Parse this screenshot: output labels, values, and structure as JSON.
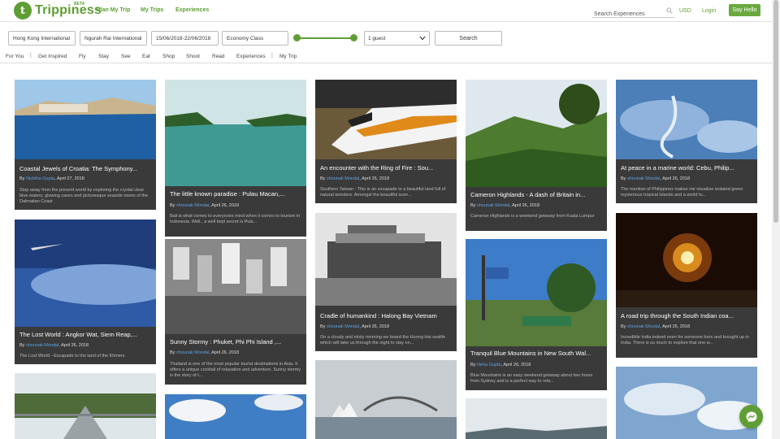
{
  "brand": {
    "name": "Trippiness",
    "beta": "BETA",
    "logo_letter": "t",
    "color": "#5f9e34"
  },
  "nav": {
    "items": [
      "Plan My Trip",
      "My Trips",
      "Experiences"
    ]
  },
  "header": {
    "search_placeholder": "Search Experiences",
    "currency": "USD",
    "login": "Login",
    "say_hello": "Say Hello"
  },
  "search": {
    "from": "Hong Kong International",
    "to": "Ngurah Rai International",
    "dates": "15/06/2018-22/06/2018",
    "cabin": "Economy Class",
    "guests": "1 guest",
    "button": "Search"
  },
  "tabs": [
    "For You",
    "Get Inspired",
    "Fly",
    "Stay",
    "See",
    "Eat",
    "Shop",
    "Shoot",
    "Read",
    "Experiences",
    "My Trip"
  ],
  "cards": [
    {
      "title": "Coastal Jewels of Croatia: The Symphony...",
      "author": "Nishtha Gupta",
      "date": ", April 27, 2018",
      "desc": "Step away from the present world by exploring the crystal clear blue waters, glowing caves and picturesque seaside towns of the Dalmatian Coast",
      "by": "By "
    },
    {
      "title": "The Lost World : Angkor Wat, Siem Reap,...",
      "author": "shounak Mondal",
      "date": ", April 26, 2018",
      "desc": "The Lost World - Escapade to the land of the Khmers",
      "by": "By "
    },
    {
      "title": "The little known paradise : Pulau Macan,...",
      "author": "shounak Mondal",
      "date": ", April 26, 2018",
      "desc": "Bali is what comes to everyones mind when it comes to tourism in Indonesia. Well , a well kept secret is Pula...",
      "by": "By "
    },
    {
      "title": "Sunny Stormy : Phuket, Phi Phi Island ,...",
      "author": "shounak Mondal",
      "date": ", April 26, 2018",
      "desc": "Thailand is one of the most popular tourist destinations in Asia. It offers a unique cocktail of relaxation and adventure, Sunny stormy is the story of t...",
      "by": "By "
    },
    {
      "title": "An encounter with the Ring of Fire : Sou...",
      "author": "shounak Mondal",
      "date": ", April 26, 2018",
      "desc": "Southern Taiwan - This is an escapade to a beautiful land full of natural wonders. Amongst the beautiful scen...",
      "by": "By "
    },
    {
      "title": "Cradle of humankind : Halong Bay Vietnam",
      "author": "shounak Mondal",
      "date": ", April 26, 2018",
      "desc": "On a cloudy and misty morning we board the Huong Hai sealife which will take us through the night to stay on...",
      "by": "By "
    },
    {
      "title": "Cameron Highlands - A dash of Britain in...",
      "author": "shounak Mondal",
      "date": ", April 26, 2018",
      "desc": "Cameron Highlands is a weekend getaway from Kuala Lumpur",
      "by": "By "
    },
    {
      "title": "Tranquil Blue Mountains in New South Wal...",
      "author": "Neha Gupta",
      "date": ", April 26, 2018",
      "desc": "Blue Mountains is an easy weekend getaway about two hours from Sydney and is a perfect way to rela...",
      "by": "By "
    },
    {
      "title": "At peace in a marine world: Cebu, Philip...",
      "author": "shounak Mondal",
      "date": ", April 26, 2018",
      "desc": "The mention of Philippines makes me visualize isolated green mysterious tropical islands and a world fu...",
      "by": "By "
    },
    {
      "title": "A road trip through the South Indian coa...",
      "author": "shounak Mondal",
      "date": ", April 26, 2018",
      "desc": "Incredible India indeed even for someone born and brought up in India. There is so much to explore that one w...",
      "by": "By "
    }
  ]
}
